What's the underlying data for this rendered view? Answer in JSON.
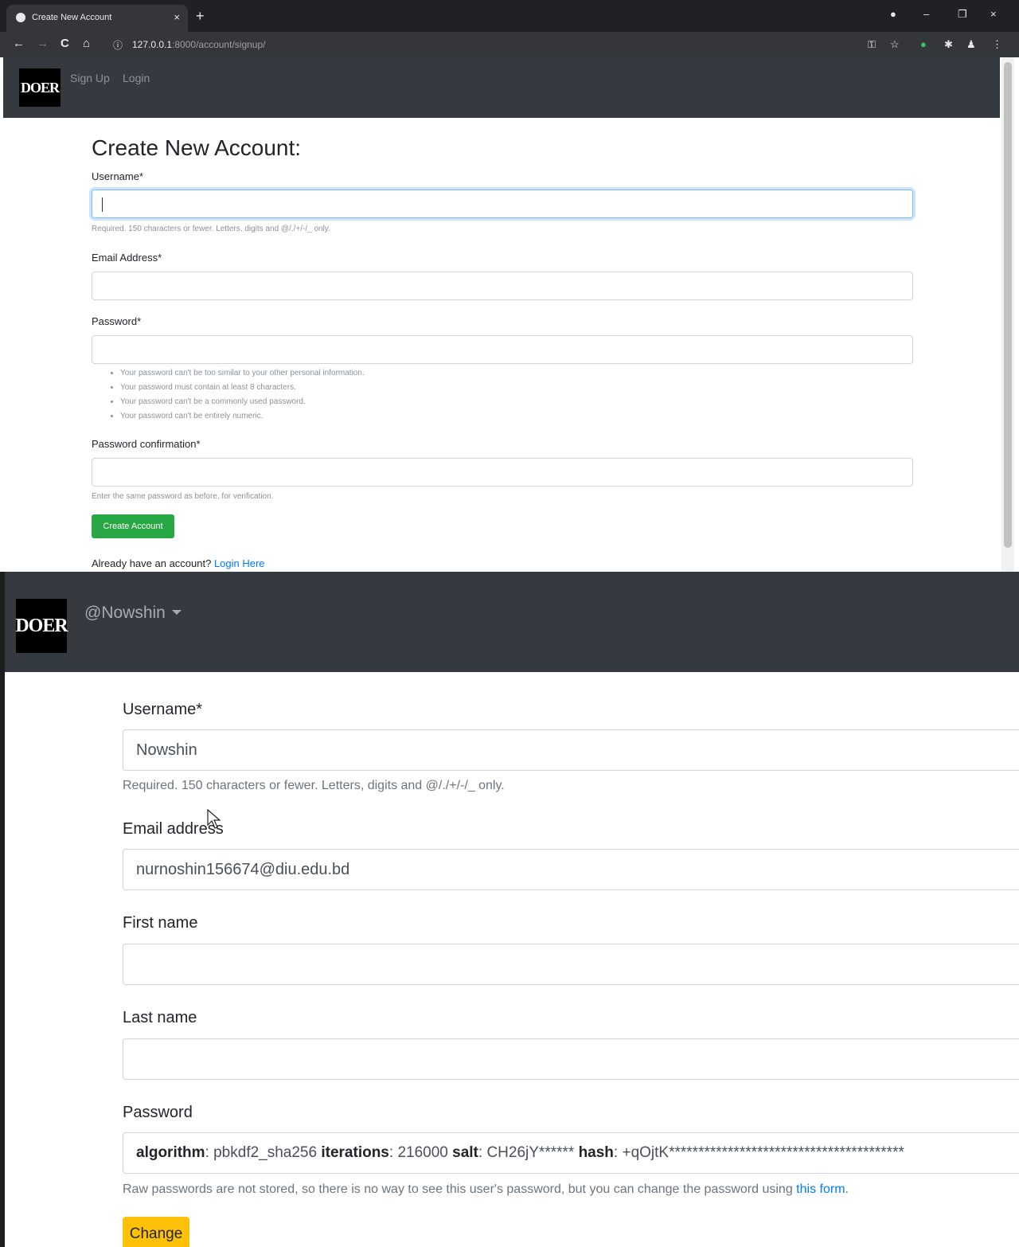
{
  "browser": {
    "tab_title": "Create New Account",
    "tab_close": "×",
    "new_tab": "+",
    "url_host": "127.0.0.1",
    "url_path": ":8000/account/signup/",
    "back": "←",
    "forward": "→",
    "reload": "C",
    "home": "⌂",
    "info": "ⓘ",
    "minimize": "–",
    "restore": "❐",
    "close": "×"
  },
  "signup_page": {
    "logo": "DOER",
    "nav": {
      "signup": "Sign Up",
      "login": "Login"
    },
    "title": "Create New Account:",
    "username_label": "Username*",
    "username_help": "Required. 150 characters or fewer. Letters, digits and @/./+/-/_ only.",
    "email_label": "Email Address*",
    "password_label": "Password*",
    "password_rules": [
      "Your password can't be too similar to your other personal information.",
      "Your password must contain at least 8 characters.",
      "Your password can't be a commonly used password.",
      "Your password can't be entirely numeric."
    ],
    "confirm_label": "Password confirmation*",
    "confirm_help": "Enter the same password as before, for verification.",
    "submit": "Create Account",
    "already_text": "Already have an account? ",
    "login_link": "Login Here"
  },
  "profile_page": {
    "logo": "DOER",
    "user": "@Nowshin",
    "username_label": "Username*",
    "username_value": "Nowshin",
    "username_help": "Required. 150 characters or fewer. Letters, digits and @/./+/-/_ only.",
    "email_label": "Email address",
    "email_value": "nurnoshin156674@diu.edu.bd",
    "first_name_label": "First name",
    "last_name_label": "Last name",
    "password_label": "Password",
    "pw": {
      "algorithm_key": "algorithm",
      "algorithm_val": ": pbkdf2_sha256 ",
      "iterations_key": "iterations",
      "iterations_val": ": 216000 ",
      "salt_key": "salt",
      "salt_val": ": CH26jY****** ",
      "hash_key": "hash",
      "hash_val": ": +qOjtK****************************************"
    },
    "password_help": "Raw passwords are not stored, so there is no way to see this user's password, but you can change the password using ",
    "password_help_link": "this form",
    "password_help_end": ".",
    "change_button": "Change"
  }
}
